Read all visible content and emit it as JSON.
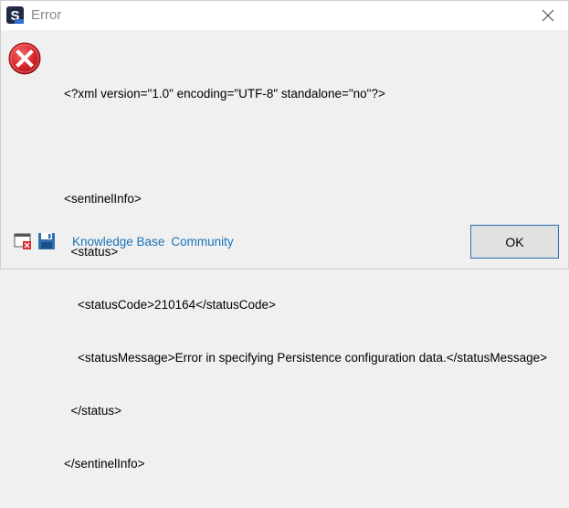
{
  "window": {
    "title": "Error",
    "app_icon_letter": "S"
  },
  "icons": {
    "app": "sentinel-app-icon",
    "close": "close-icon",
    "error": "error-icon",
    "screenshot": "window-screenshot-icon",
    "save": "save-icon"
  },
  "message": {
    "lines": [
      "<?xml version=\"1.0\" encoding=\"UTF-8\" standalone=\"no\"?>",
      "",
      "<sentinelInfo>",
      "  <status>",
      "    <statusCode>210164</statusCode>",
      "    <statusMessage>Error in specifying Persistence configuration data.</statusMessage>",
      "  </status>",
      "</sentinelInfo>"
    ]
  },
  "footer": {
    "links": [
      "Knowledge Base",
      "Community"
    ],
    "ok_label": "OK"
  },
  "colors": {
    "link": "#1a73b8",
    "error_red": "#d9262b",
    "button_border": "#3a6ea5"
  }
}
